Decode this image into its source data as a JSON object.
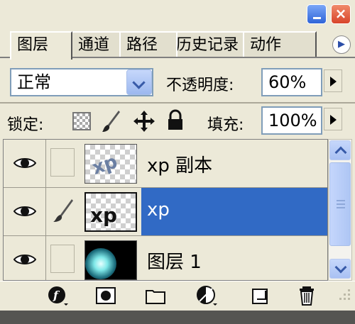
{
  "window": {
    "minimize_label": "_",
    "close_label": "×"
  },
  "tabs": [
    {
      "label": "图层"
    },
    {
      "label": "通道"
    },
    {
      "label": "路径"
    },
    {
      "label": "历史记录"
    },
    {
      "label": "动作"
    }
  ],
  "blend_mode": {
    "value": "正常"
  },
  "opacity": {
    "label": "不透明度:",
    "value": "60%"
  },
  "lock": {
    "label": "锁定:"
  },
  "fill": {
    "label": "填充:",
    "value": "100%"
  },
  "layers": [
    {
      "name": "xp 副本",
      "visible": true,
      "selected": false,
      "thumb_text": "xp"
    },
    {
      "name": "xp",
      "visible": true,
      "selected": true,
      "thumb_text": "xp"
    },
    {
      "name": "图层 1",
      "visible": true,
      "selected": false,
      "thumb_text": ""
    }
  ],
  "colors": {
    "selection": "#316ac5",
    "panel_bg": "#ece9d8",
    "xp_blue": "#2f64d8"
  },
  "icons": {
    "toolbar": [
      "layer-style-icon",
      "layer-mask-icon",
      "new-group-icon",
      "adjustment-layer-icon",
      "new-layer-icon",
      "delete-layer-icon"
    ]
  }
}
